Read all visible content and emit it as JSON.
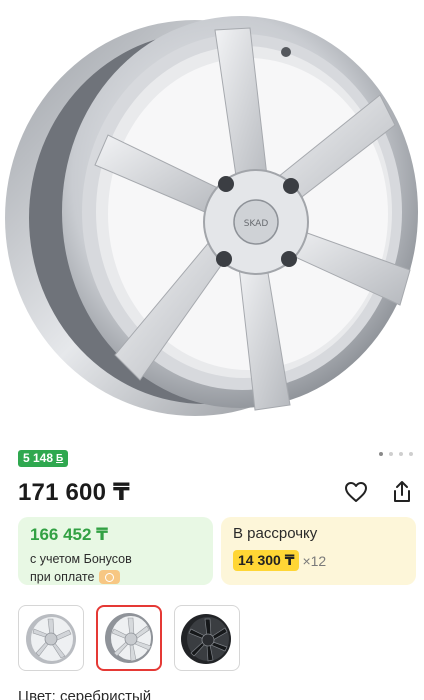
{
  "product": {
    "bonus_amount": "5 148",
    "bonus_symbol": "Б",
    "price": "171 600 ₸"
  },
  "bonus_card": {
    "price": "166 452 ₸",
    "note_line1": "с учетом Бонусов",
    "note_line2": "при оплате"
  },
  "credit_card": {
    "title": "В рассрочку",
    "monthly": "14 300 ₸",
    "multiplier": "×12"
  },
  "gallery": {
    "dots": 4,
    "active_dot": 0,
    "thumbnails": [
      "silver",
      "silver",
      "black"
    ],
    "selected_thumbnail": 1
  },
  "color": {
    "label": "Цвет: серебристый"
  },
  "icons": {
    "favorite": "heart-icon",
    "share": "share-icon",
    "pay": "kaspi-pay-icon"
  },
  "colors": {
    "bonus_green": "#2fa84f",
    "credit_yellow": "#ffd635",
    "selected_red": "#e53935"
  }
}
